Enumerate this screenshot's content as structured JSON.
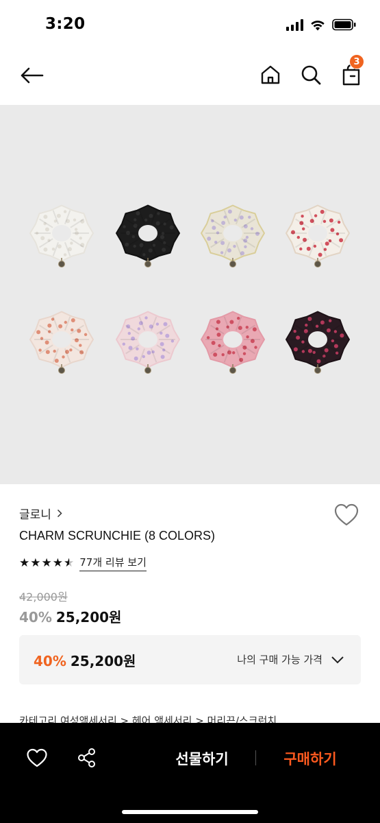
{
  "status_bar": {
    "time": "3:20"
  },
  "nav": {
    "cart_count": "3"
  },
  "product": {
    "brand": "글로니",
    "name": "CHARM SCRUNCHIE (8 COLORS)",
    "stars": [
      "★",
      "★",
      "★",
      "★",
      "★"
    ],
    "rating": 4.5,
    "review_link": "77개 리뷰 보기",
    "original_price": "42,000원",
    "discount": "40%",
    "price": "25,200원"
  },
  "my_price": {
    "discount": "40%",
    "price": "25,200원",
    "label": "나의 구매 가능 가격"
  },
  "category": {
    "text": "카테고리      여성액세서리 > 헤어 액세서리 > 머리끈/스크런치"
  },
  "bottom_bar": {
    "gift_label": "선물하기",
    "buy_label": "구매하기"
  },
  "colors": {
    "accent": "#f06420",
    "buy_text": "#ff5a1f",
    "image_bg": "#eaeaea",
    "box_bg": "#f4f4f4"
  },
  "scrunchies": [
    {
      "name": "white",
      "base": "#f3f2ee",
      "dot": "#dcd8d0",
      "edge": "#e6e3dc"
    },
    {
      "name": "black",
      "base": "#1d1d1d",
      "dot": "#333333",
      "edge": "#111111"
    },
    {
      "name": "yellow-floral",
      "base": "#e9e4d6",
      "dot": "#b7a9d4",
      "edge": "#d9ce9a"
    },
    {
      "name": "cherry",
      "base": "#f4efe8",
      "dot": "#c8283a",
      "edge": "#e2d4c4"
    },
    {
      "name": "peach-floral",
      "base": "#f3e6df",
      "dot": "#d9795e",
      "edge": "#e8d6cc"
    },
    {
      "name": "pink-lilac",
      "base": "#f0d9dc",
      "dot": "#b79ed9",
      "edge": "#ecc9cf"
    },
    {
      "name": "rose",
      "base": "#e9a8b3",
      "dot": "#c73a4e",
      "edge": "#e39aa7"
    },
    {
      "name": "dark-floral",
      "base": "#2a1b22",
      "dot": "#d7416a",
      "edge": "#1d1217"
    }
  ]
}
